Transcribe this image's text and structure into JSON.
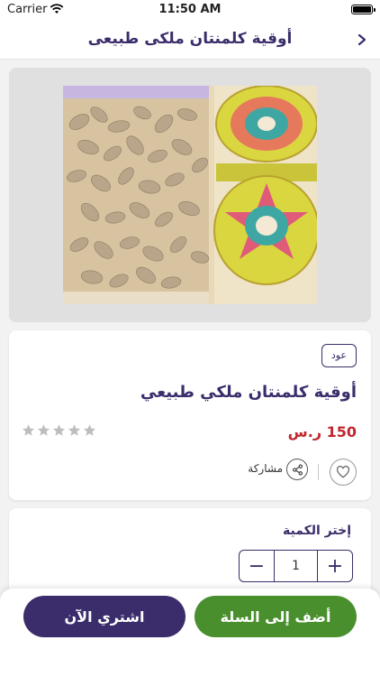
{
  "status_bar": {
    "carrier": "Carrier",
    "time": "11:50 AM"
  },
  "nav": {
    "title": "أوقية كلمنتان ملكى طبيعى",
    "back_icon": "chevron-right-icon"
  },
  "product": {
    "tag": "عود",
    "title": "أوقية كلمنتان ملكي طبيعي",
    "price": "150 ر.س",
    "rating": {
      "value": 0,
      "max": 5
    },
    "share_label": "مشاركة"
  },
  "quantity": {
    "label": "إختر الكمية",
    "value": "1",
    "decrement": "−",
    "increment": "+"
  },
  "actions": {
    "add_to_cart": "أضف إلى السلة",
    "buy_now": "اشتري الآن"
  },
  "colors": {
    "primary": "#3b2d6b",
    "green": "#4a8f2e",
    "price": "#c0262d"
  }
}
